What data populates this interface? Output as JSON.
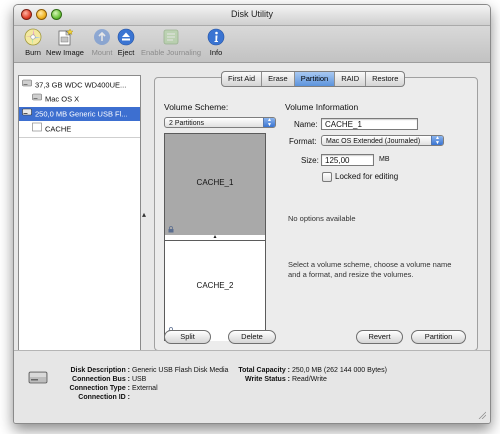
{
  "window": {
    "title": "Disk Utility"
  },
  "toolbar": {
    "items": [
      {
        "label": "Burn"
      },
      {
        "label": "New Image"
      },
      {
        "label": "Mount"
      },
      {
        "label": "Eject"
      },
      {
        "label": "Enable Journaling"
      },
      {
        "label": "Info"
      }
    ]
  },
  "sidebar": {
    "items": [
      {
        "label": "37,3 GB WDC WD400UE..."
      },
      {
        "label": "Mac OS X"
      },
      {
        "label": "250,0 MB Generic USB Fl..."
      },
      {
        "label": "CACHE"
      }
    ],
    "selected_index": 2
  },
  "tabs": [
    "First Aid",
    "Erase",
    "Partition",
    "RAID",
    "Restore"
  ],
  "active_tab": "Partition",
  "partition": {
    "volume_scheme_label": "Volume Scheme:",
    "volume_scheme_value": "2 Partitions",
    "volume_info_label": "Volume Information",
    "partitions": [
      "CACHE_1",
      "CACHE_2"
    ],
    "name_label": "Name:",
    "name_value": "CACHE_1",
    "format_label": "Format:",
    "format_value": "Mac OS Extended (Journaled)",
    "size_label": "Size:",
    "size_value": "125,00",
    "size_unit": "MB",
    "locked_label": "Locked for editing",
    "no_options": "No options available",
    "help_text_1": "Select a volume scheme, choose a volume name",
    "help_text_2": "and a format, and resize the volumes.",
    "split_button": "Split",
    "delete_button": "Delete",
    "revert_button": "Revert",
    "partition_button": "Partition"
  },
  "info": {
    "disk_description_label": "Disk Description :",
    "disk_description_value": "Generic USB Flash Disk Media",
    "connection_bus_label": "Connection Bus :",
    "connection_bus_value": "USB",
    "connection_type_label": "Connection Type :",
    "connection_type_value": "External",
    "connection_id_label": "Connection ID :",
    "connection_id_value": "",
    "total_capacity_label": "Total Capacity :",
    "total_capacity_value": "250,0 MB (262 144 000 Bytes)",
    "write_status_label": "Write Status :",
    "write_status_value": "Read/Write"
  },
  "colors": {
    "selection": "#3d6fd0",
    "partition_selected": "#a9a9a9",
    "accent": "#3a74d2"
  }
}
